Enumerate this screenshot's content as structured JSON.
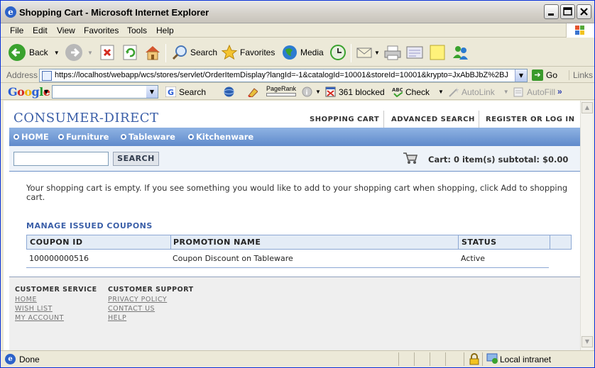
{
  "window": {
    "title": "Shopping Cart - Microsoft Internet Explorer"
  },
  "menu": [
    "File",
    "Edit",
    "View",
    "Favorites",
    "Tools",
    "Help"
  ],
  "toolbar": {
    "back": "Back",
    "search": "Search",
    "favorites": "Favorites",
    "media": "Media"
  },
  "address": {
    "label": "Address",
    "url": "https://localhost/webapp/wcs/stores/servlet/OrderItemDisplay?langId=-1&catalogId=10001&storeId=10001&krypto=JxAbBJbZ%2BJ",
    "go": "Go",
    "links": "Links"
  },
  "google_bar": {
    "search": "Search",
    "pagerank": "PageRank",
    "blocked": "361 blocked",
    "check": "Check",
    "autolink": "AutoLink",
    "autofill": "AutoFill",
    "more": "»"
  },
  "site": {
    "logo": "CONSUMER-DIRECT",
    "nav": [
      "SHOPPING CART",
      "ADVANCED SEARCH",
      "REGISTER OR LOG IN"
    ],
    "categories": [
      "HOME",
      "Furniture",
      "Tableware",
      "Kitchenware"
    ],
    "search_button": "SEARCH",
    "search_value": "",
    "cart_summary": "Cart: 0 item(s) subtotal: $0.00",
    "empty_message": "Your shopping cart is empty. If you see something you would like to add to your shopping cart when shopping, click Add to shopping cart.",
    "coupons": {
      "heading": "MANAGE ISSUED COUPONS",
      "columns": [
        "COUPON ID",
        "PROMOTION NAME",
        "STATUS"
      ],
      "rows": [
        {
          "id": "100000000516",
          "promotion": "Coupon Discount on Tableware",
          "status": "Active"
        }
      ]
    },
    "footer": {
      "service_title": "CUSTOMER SERVICE",
      "service_links": [
        "HOME",
        "WISH LIST",
        "MY ACCOUNT"
      ],
      "support_title": "CUSTOMER SUPPORT",
      "support_links": [
        "PRIVACY POLICY",
        "CONTACT US",
        "HELP"
      ]
    }
  },
  "status": {
    "text": "Done",
    "zone": "Local intranet"
  }
}
